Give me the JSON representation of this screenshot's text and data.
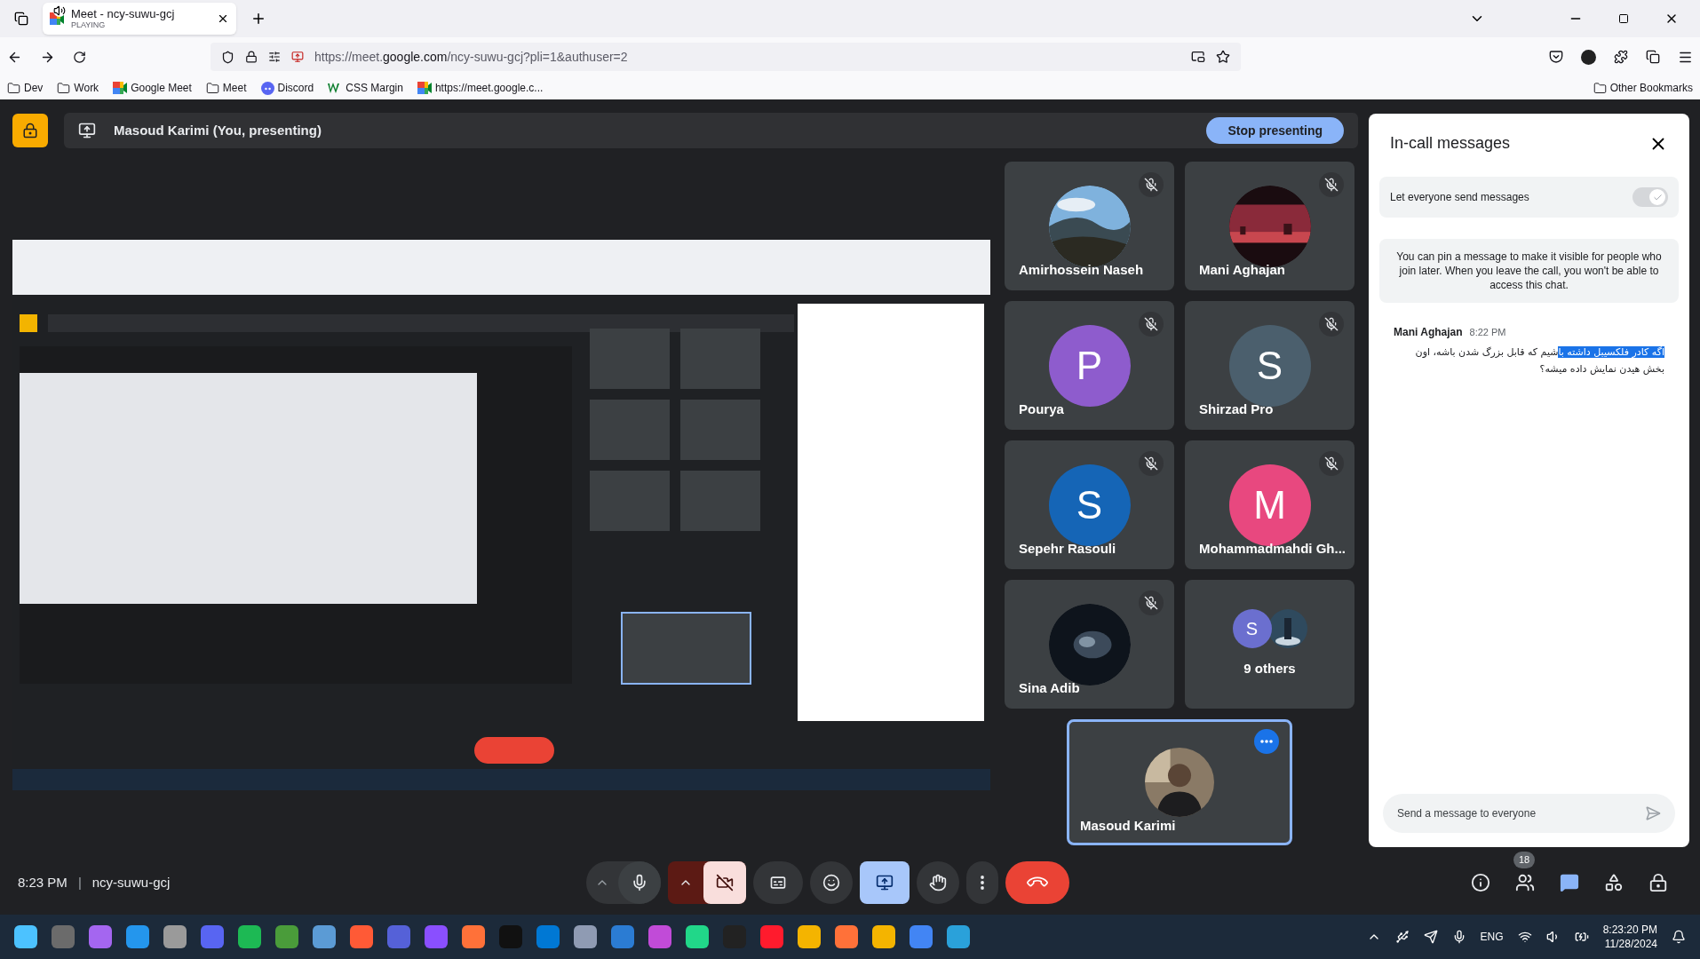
{
  "browser": {
    "tab": {
      "title": "Meet - ncy-suwu-gcj",
      "status": "PLAYING"
    },
    "url_host": "https://meet.",
    "url_domain": "google.com",
    "url_path": "/ncy-suwu-gcj?pli=1&authuser=2",
    "bookmarks": [
      {
        "label": "Dev",
        "kind": "folder"
      },
      {
        "label": "Work",
        "kind": "folder"
      },
      {
        "label": "Google Meet",
        "kind": "meet"
      },
      {
        "label": "Meet",
        "kind": "folder"
      },
      {
        "label": "Discord",
        "kind": "discord"
      },
      {
        "label": "CSS Margin",
        "kind": "w"
      },
      {
        "label": "https://meet.google.c...",
        "kind": "meet"
      }
    ],
    "other_bookmarks": "Other Bookmarks"
  },
  "presenting_bar": {
    "label": "Masoud Karimi (You, presenting)",
    "button": "Stop presenting"
  },
  "participants": [
    {
      "name": "Amirhossein Naseh",
      "muted": true
    },
    {
      "name": "Mani Aghajan",
      "muted": true
    },
    {
      "name": "Pourya",
      "kind": "initial",
      "initial": "P",
      "color": "#8e5ccd",
      "muted": true
    },
    {
      "name": "Shirzad Pro",
      "kind": "initial",
      "initial": "S",
      "color": "#4b5f6d",
      "muted": true
    },
    {
      "name": "Sepehr Rasouli",
      "kind": "initial",
      "initial": "S",
      "color": "#1565b6",
      "muted": true
    },
    {
      "name": "Mohammadmahdi Gh...",
      "kind": "initial",
      "initial": "M",
      "color": "#e8487f",
      "muted": true
    },
    {
      "name": "Sina Adib",
      "muted": true
    },
    {
      "name": "9 others",
      "kind": "others",
      "initial": "S",
      "color": "#6b6fcf",
      "muted": false
    }
  ],
  "self_tile": {
    "name": "Masoud Karimi",
    "selected": true
  },
  "chat": {
    "title": "In-call messages",
    "toggle": {
      "label": "Let everyone send messages",
      "on": true
    },
    "info": "You can pin a message to make it visible for people who join later. When you leave the call, you won't be able to access this chat.",
    "messages": [
      {
        "sender": "Mani Aghajan",
        "time": "8:22 PM",
        "parts": [
          {
            "text": "اگه کادر فلکسیبل داشته با",
            "selected": true
          },
          {
            "text": "شیم که قابل بزرگ شدن باشه، اون بخش هیدن نمایش داده میشه؟",
            "selected": false
          }
        ]
      }
    ],
    "input_placeholder": "Send a message to everyone"
  },
  "call_bar": {
    "time": "8:23 PM",
    "separator": "|",
    "meeting_code": "ncy-suwu-gcj",
    "camera_on": false,
    "presenting": true,
    "people_count": "18"
  },
  "taskbar": {
    "language": "ENG",
    "time": "8:23:20 PM",
    "date": "11/28/2024"
  }
}
